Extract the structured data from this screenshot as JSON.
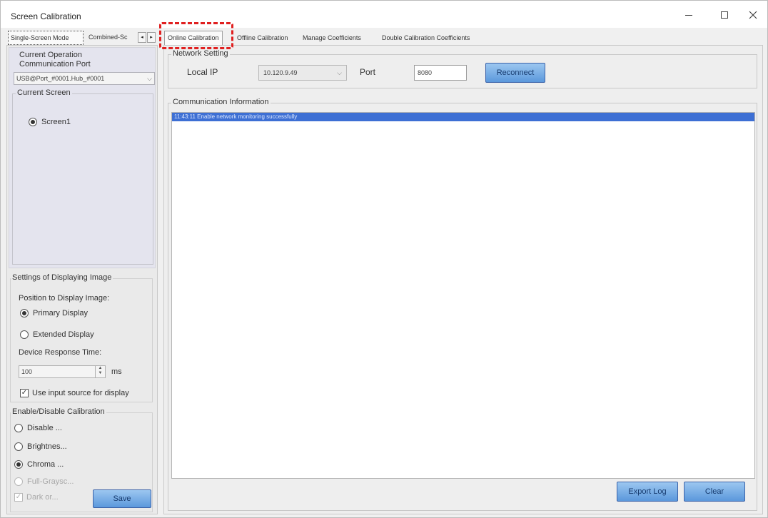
{
  "window": {
    "title": "Screen Calibration"
  },
  "left_tabs": [
    {
      "label": "Single-Screen Mode"
    },
    {
      "label": "Combined-Sc"
    }
  ],
  "left_panel": {
    "current_operation_label": "Current Operation",
    "communication_port_label": "Communication Port",
    "communication_port_value": "USB@Port_#0001.Hub_#0001",
    "current_screen_label": "Current Screen",
    "screen_option": "Screen1",
    "display_settings": {
      "group_label": "Settings of Displaying Image",
      "position_label": "Position to Display Image:",
      "primary_display": "Primary Display",
      "extended_display": "Extended Display",
      "response_time_label": "Device Response Time:",
      "response_time_value": "100",
      "response_time_unit": "ms",
      "use_input_source": "Use input source for display"
    },
    "calibration": {
      "group_label": "Enable/Disable Calibration",
      "disable": "Disable ...",
      "brightness": "Brightnes...",
      "chroma": "Chroma ...",
      "full_grayscale": "Full-Graysc...",
      "dark_or": "Dark or...",
      "save_label": "Save"
    }
  },
  "right_tabs": [
    {
      "label": "Online Calibration"
    },
    {
      "label": "Offline Calibration"
    },
    {
      "label": "Manage Coefficients"
    },
    {
      "label": "Double Calibration Coefficients"
    }
  ],
  "network": {
    "group_label": "Network Setting",
    "local_ip_label": "Local IP",
    "local_ip_value": "10.120.9.49",
    "port_label": "Port",
    "port_value": "8080",
    "reconnect_label": "Reconnect"
  },
  "communication": {
    "group_label": "Communication Information",
    "log": [
      "11:43:11  Enable network monitoring successfully"
    ]
  },
  "footer": {
    "export_label": "Export Log",
    "clear_label": "Clear"
  },
  "colors": {
    "highlight": "#e02020",
    "button_blue": "#5b98dc",
    "selected_row": "#3d6fd4"
  }
}
